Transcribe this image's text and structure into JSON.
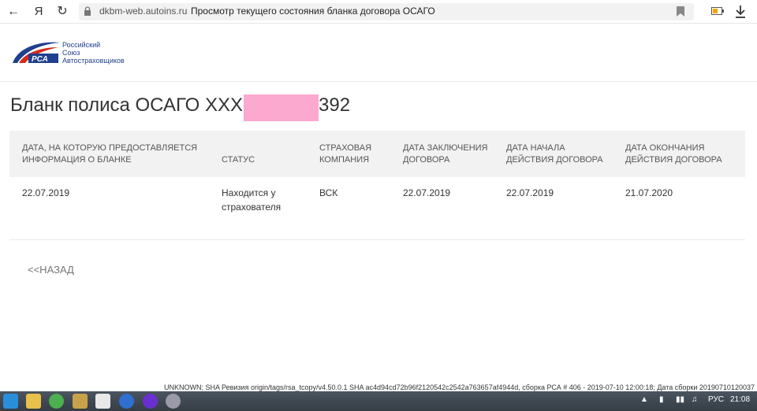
{
  "browser": {
    "domain": "dkbm-web.autoins.ru",
    "page_title": "Просмотр текущего состояния бланка договора ОСАГО",
    "yandex_label": "Я"
  },
  "logo": {
    "line1": "Российский",
    "line2": "Союз",
    "line3": "Автостраховщиков",
    "mark": "РСА"
  },
  "page": {
    "title_prefix": "Бланк полиса ОСАГО XXX",
    "title_suffix": "392"
  },
  "table": {
    "headers": [
      "ДАТА, НА КОТОРУЮ ПРЕДОСТАВЛЯЕТСЯ ИНФОРМАЦИЯ О БЛАНКЕ",
      "СТАТУС",
      "СТРАХОВАЯ КОМПАНИЯ",
      "ДАТА ЗАКЛЮЧЕНИЯ ДОГОВОРА",
      "ДАТА НАЧАЛА ДЕЙСТВИЯ ДОГОВОРА",
      "ДАТА ОКОНЧАНИЯ ДЕЙСТВИЯ ДОГОВОРА"
    ],
    "row": [
      "22.07.2019",
      "Находится у страхователя",
      "ВСК",
      "22.07.2019",
      "22.07.2019",
      "21.07.2020"
    ]
  },
  "back_link": "<<НАЗАД",
  "build_info": "UNKNOWN; SHA Ревизия origin/tags/rsa_tcopy/v4.50.0.1 SHA ac4d94cd72b96f2120542c2542a763657af4944d, сборка РСА # 406 - 2019-07-10 12:00:18; Дата сборки 20190710120037",
  "taskbar": {
    "lang": "РУС",
    "time": "21:08"
  },
  "colors": {
    "accent_blue": "#1f3f8f",
    "logo_red": "#d52b1e",
    "redaction": "#fca9cf",
    "header_bg": "#f2f2f2"
  }
}
